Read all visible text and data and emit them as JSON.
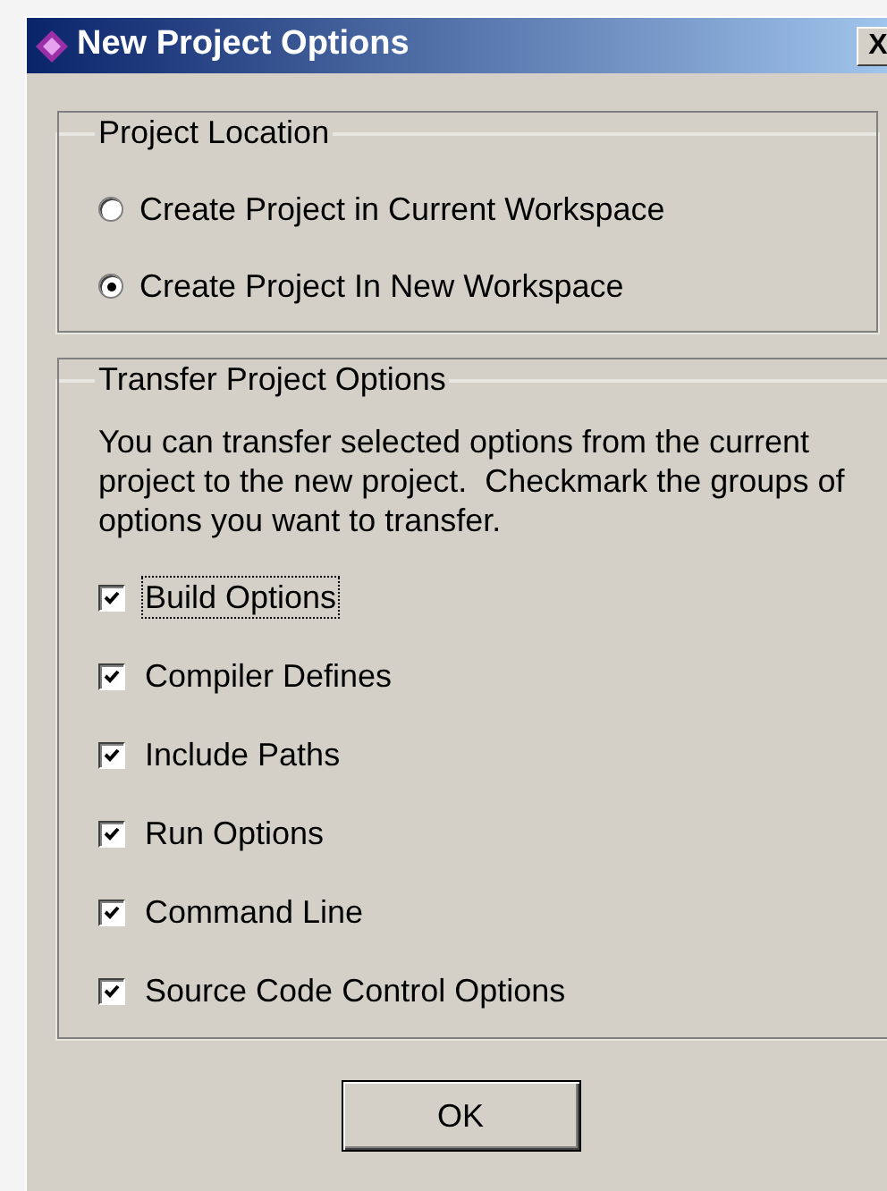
{
  "window": {
    "title": "New Project Options",
    "close": "X"
  },
  "project_location": {
    "title": "Project Location",
    "options": [
      {
        "label": "Create Project in Current Workspace",
        "selected": false
      },
      {
        "label": "Create Project In New Workspace",
        "selected": true
      }
    ]
  },
  "transfer_options": {
    "title": "Transfer Project Options",
    "description": "You can transfer selected options from the current project to the new project.  Checkmark the groups of options you want to transfer.",
    "options": [
      {
        "label": "Build Options",
        "checked": true,
        "focused": true
      },
      {
        "label": "Compiler Defines",
        "checked": true,
        "focused": false
      },
      {
        "label": "Include Paths",
        "checked": true,
        "focused": false
      },
      {
        "label": "Run Options",
        "checked": true,
        "focused": false
      },
      {
        "label": "Command Line",
        "checked": true,
        "focused": false
      },
      {
        "label": "Source Code Control Options",
        "checked": true,
        "focused": false
      }
    ]
  },
  "buttons": [
    "OK"
  ]
}
